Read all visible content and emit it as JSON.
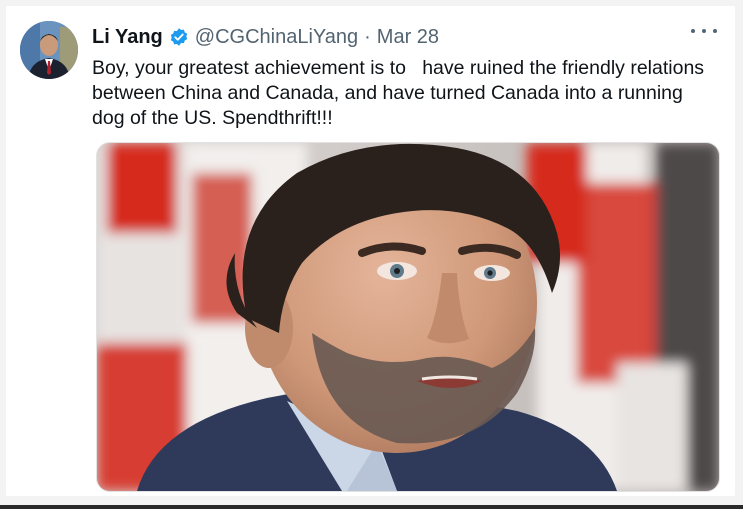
{
  "tweet": {
    "display_name": "Li Yang",
    "handle": "@CGChinaLiYang",
    "separator": "·",
    "date": "Mar 28",
    "text": "Boy, your greatest achievement is to   have ruined the friendly relations between China and Canada, and have turned Canada into a running dog of the US. Spendthrift!!!",
    "verified": true
  },
  "icons": {
    "verified": "verified-check-icon",
    "more": "more-horizontal-icon"
  },
  "colors": {
    "name": "#0f1419",
    "secondary": "#536471",
    "verified_blue": "#1d9bf0",
    "flag_red": "#d52b1e"
  }
}
